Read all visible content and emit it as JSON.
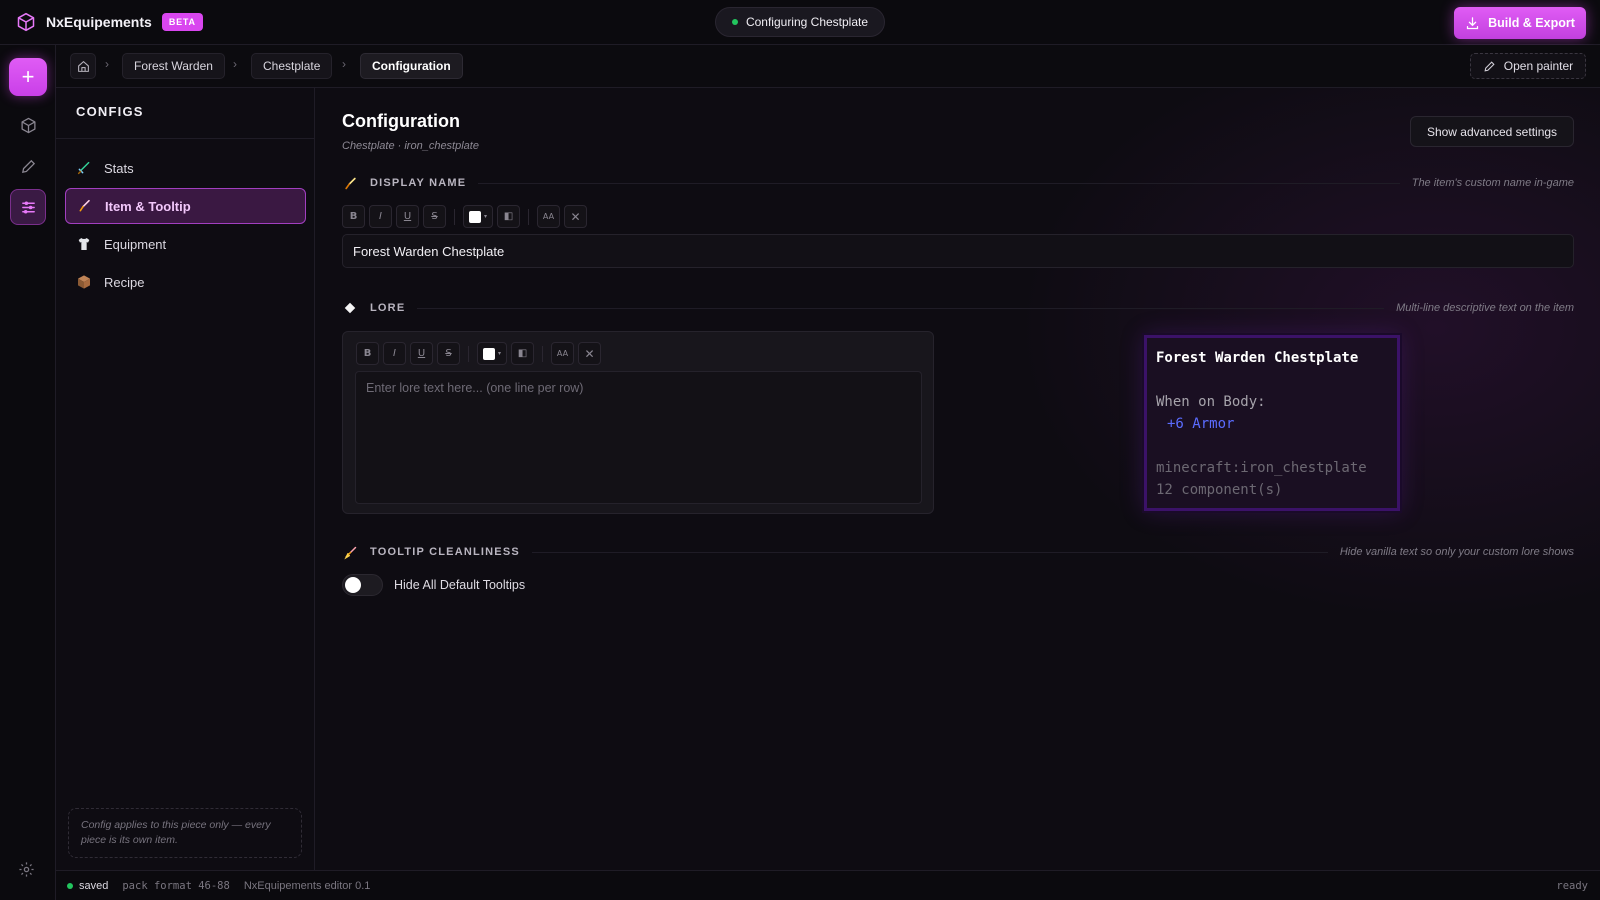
{
  "app": {
    "name": "NxEquipements",
    "badge": "BETA"
  },
  "topbar": {
    "status_text": "Configuring Chestplate",
    "build_label": "Build & Export"
  },
  "rail": {
    "add_icon": "plus-icon",
    "items": [
      "cube-icon",
      "pencil-icon",
      "sliders-icon"
    ],
    "settings_icon": "gear-icon"
  },
  "breadcrumb": {
    "items": [
      "Forest Warden",
      "Chestplate",
      "Configuration"
    ],
    "painter_label": "Open painter"
  },
  "sidebar": {
    "title": "CONFIGS",
    "items": [
      {
        "label": "Stats",
        "icon": "sword-icon"
      },
      {
        "label": "Item & Tooltip",
        "icon": "brush-icon"
      },
      {
        "label": "Equipment",
        "icon": "shirt-icon"
      },
      {
        "label": "Recipe",
        "icon": "crate-icon"
      }
    ],
    "note": "Config applies to this piece only — every piece is its own item."
  },
  "main": {
    "title": "Configuration",
    "subtitle": "Chestplate · iron_chestplate",
    "advanced_label": "Show advanced settings",
    "display_name": {
      "title": "DISPLAY NAME",
      "hint": "The item's custom name in-game",
      "value": "Forest Warden Chestplate"
    },
    "lore": {
      "title": "LORE",
      "hint": "Multi-line descriptive text on the item",
      "placeholder": "Enter lore text here... (one line per row)"
    },
    "toolbar": {
      "bold": "B",
      "italic": "I",
      "underline": "U",
      "strike": "S",
      "size": "AA"
    },
    "tooltip": {
      "title": "Forest Warden Chestplate",
      "slot_line": "When on Body:",
      "stat_line": "+6 Armor",
      "id_line": "minecraft:iron_chestplate",
      "components_line": "12 component(s)"
    },
    "cleanliness": {
      "title": "TOOLTIP CLEANLINESS",
      "hint": "Hide vanilla text so only your custom lore shows",
      "toggle_label": "Hide All Default Tooltips",
      "toggle_on": false
    }
  },
  "statusbar": {
    "saved": "saved",
    "pack_format": "pack format 46-88",
    "editor": "NxEquipements editor 0.1",
    "state": "ready"
  },
  "colors": {
    "accent": "#d946ef",
    "status_ok": "#22c55e",
    "tooltip_stat": "#5b6cff"
  }
}
